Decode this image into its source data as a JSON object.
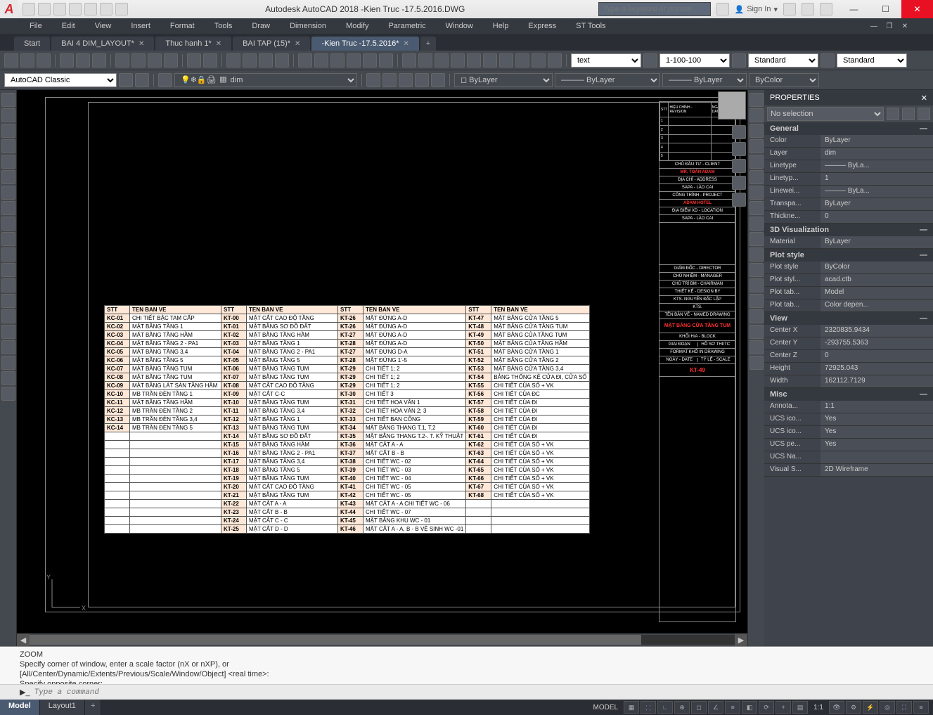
{
  "app": {
    "title": "Autodesk AutoCAD 2018    -Kien Truc -17.5.2016.DWG",
    "search_placeholder": "Type a keyword or phrase",
    "signin": "Sign In"
  },
  "menubar": [
    "File",
    "Edit",
    "View",
    "Insert",
    "Format",
    "Tools",
    "Draw",
    "Dimension",
    "Modify",
    "Parametric",
    "Window",
    "Help",
    "Express",
    "ST Tools"
  ],
  "tabs": [
    {
      "label": "Start",
      "active": false
    },
    {
      "label": "BAI 4 DIM_LAYOUT*",
      "active": false
    },
    {
      "label": "Thuc hanh 1*",
      "active": false
    },
    {
      "label": "BAI TAP (15)*",
      "active": false
    },
    {
      "label": "-Kien Truc -17.5.2016*",
      "active": true
    }
  ],
  "toolbar1": {
    "combo1": "text",
    "combo2": "1-100-100",
    "combo3": "Standard",
    "combo4": "Standard"
  },
  "toolbar2": {
    "workspace": "AutoCAD Classic",
    "layer_combo": "dim",
    "layer1": "ByLayer",
    "layer2": "ByLayer",
    "layer3": "ByLayer",
    "layer4": "ByColor"
  },
  "drawing_table": {
    "headers": [
      "STT",
      "TEN BAN VE",
      "STT",
      "TEN BAN VE",
      "STT",
      "TEN BAN VE",
      "STT",
      "TEN BAN VE"
    ],
    "rows": [
      [
        "KC-01",
        "CHI TIẾT BẬC TAM CẤP",
        "KT-00",
        "MẶT CẮT CAO ĐỘ TẦNG",
        "KT-26",
        "MẶT ĐỨNG A-D",
        "KT-47",
        "MẶT BẰNG CỬA TẦNG 5"
      ],
      [
        "KC-02",
        "MẶT BẰNG TẦNG 1",
        "KT-01",
        "MẶT BẰNG SƠ ĐỒ ĐẤT",
        "KT-26",
        "MẶT ĐỨNG A-D",
        "KT-48",
        "MẶT BẰNG CỬA TẦNG TUM"
      ],
      [
        "KC-03",
        "MẶT BẰNG TẦNG HẦM",
        "KT-02",
        "MẶT BẰNG TẦNG HẦM",
        "KT-27",
        "MẶT ĐỨNG A-D",
        "KT-49",
        "MẶT BẰNG CỦA TẦNG TUM"
      ],
      [
        "KC-04",
        "MẶT BẰNG TẦNG 2 - PA1",
        "KT-03",
        "MẶT BẰNG TẦNG 1",
        "KT-28",
        "MẶT ĐỨNG A-D",
        "KT-50",
        "MẶT BẰNG CỦA TẦNG HẦM"
      ],
      [
        "KC-05",
        "MẶT BẰNG TẦNG 3,4",
        "KT-04",
        "MẶT BẰNG TẦNG 2 - PA1",
        "KT-27",
        "MẶT ĐỨNG D-A",
        "KT-51",
        "MẶT BẰNG CỬA TẦNG 1"
      ],
      [
        "KC-06",
        "MẶT BẰNG TẦNG 5",
        "KT-05",
        "MẶT BẰNG TẦNG 5",
        "KT-28",
        "MẶT ĐỨNG 1'-5",
        "KT-52",
        "MẶT BẰNG CỬA TẦNG 2"
      ],
      [
        "KC-07",
        "MẶT BẰNG TẦNG TUM",
        "KT-06",
        "MẶT BẰNG TẦNG TUM",
        "KT-29",
        "CHI TIẾT 1; 2",
        "KT-53",
        "MẶT BẰNG CỬA TẦNG 3,4"
      ],
      [
        "KC-08",
        "MẶT BẰNG TẦNG TUM",
        "KT-07",
        "MẶT BẰNG TẦNG TUM",
        "KT-29",
        "CHI TIẾT 1; 2",
        "KT-54",
        "BẢNG THỐNG KÊ CỬA ĐI, CỬA SỔ"
      ],
      [
        "KC-09",
        "MẶT BẰNG LÁT SÀN TẦNG HẦM",
        "KT-08",
        "MẶT CẮT CAO ĐỘ TẦNG",
        "KT-29",
        "CHI TIẾT 1; 2",
        "KT-55",
        "CHI TIẾT CỦA SỔ + VK"
      ],
      [
        "KC-10",
        "MB TRẦN ĐÈN TẦNG 1",
        "KT-09",
        "MẶT CẮT C-C",
        "KT-30",
        "CHI TIẾT 3",
        "KT-56",
        "CHI TIẾT CỦA ĐC"
      ],
      [
        "KC-11",
        "MẶT BẰNG TẦNG HẦM",
        "KT-10",
        "MẶT BẰNG TẦNG TUM",
        "KT-31",
        "CHI TIẾT HOA VĂN 1",
        "KT-57",
        "CHI TIẾT CỦA ĐI"
      ],
      [
        "KC-12",
        "MB TRẦN ĐÈN TẦNG 2",
        "KT-11",
        "MẶT BẰNG TẦNG 3,4",
        "KT-32",
        "CHI TIẾT HOA VĂN 2; 3",
        "KT-58",
        "CHI TIẾT CỦA ĐI"
      ],
      [
        "KC-13",
        "MB TRẦN ĐÈN TẦNG 3,4",
        "KT-12",
        "MẶT BẰNG TẦNG 1",
        "KT-33",
        "CHI TIẾT BAN CÔNG",
        "KT-59",
        "CHI TIẾT CỦA ĐI"
      ],
      [
        "KC-14",
        "MB TRẦN ĐÈN TẦNG 5",
        "KT-13",
        "MẶT BẰNG TẦNG TUM",
        "KT-34",
        "MẶT BẰNG THANG T.1, T.2",
        "KT-60",
        "CHI TIẾT CỦA ĐI"
      ],
      [
        "",
        "",
        "KT-14",
        "MẶT BẰNG SƠ ĐỒ ĐẤT",
        "KT-35",
        "MẶT BẰNG THANG T.2-. T. KỸ THUẬT",
        "KT-61",
        "CHI TIẾT CỦA ĐI"
      ],
      [
        "",
        "",
        "KT-15",
        "MẶT BẰNG TẦNG HẦM",
        "KT-36",
        "MẶT CẮT A - A",
        "KT-62",
        "CHI TIẾT CỦA SỔ + VK"
      ],
      [
        "",
        "",
        "KT-16",
        "MẶT BẰNG TẦNG 2 - PA1",
        "KT-37",
        "MẶT CẮT B - B",
        "KT-63",
        "CHI TIẾT CỦA SỔ + VK"
      ],
      [
        "",
        "",
        "KT-17",
        "MẶT BẰNG TẦNG 3,4",
        "KT-38",
        "CHI TIẾT WC - 02",
        "KT-64",
        "CHI TIẾT CỦA SỔ + VK"
      ],
      [
        "",
        "",
        "KT-18",
        "MẶT BẰNG TẦNG 5",
        "KT-39",
        "CHI TIẾT WC - 03",
        "KT-65",
        "CHI TIẾT CỦA SỔ + VK"
      ],
      [
        "",
        "",
        "KT-19",
        "MẶT BẰNG TẦNG TUM",
        "KT-40",
        "CHI TIẾT WC - 04",
        "KT-66",
        "CHI TIẾT CỦA SỔ + VK"
      ],
      [
        "",
        "",
        "KT-20",
        "MẶT CẮT CAO ĐỘ TẦNG",
        "KT-41",
        "CHI TIẾT WC - 05",
        "KT-67",
        "CHI TIẾT CỦA SỔ + VK"
      ],
      [
        "",
        "",
        "KT-21",
        "MẶT BẰNG TẦNG TUM",
        "KT-42",
        "CHI TIẾT WC - 05",
        "KT-68",
        "CHI TIẾT CỦA SỔ + VK"
      ],
      [
        "",
        "",
        "KT-22",
        "MẶT CẮT A - A",
        "KT-43",
        "MẶT CẮT A - A CHI TIẾT WC - 06",
        "",
        ""
      ],
      [
        "",
        "",
        "KT-23",
        "MẶT CẮT B - B",
        "KT-44",
        "CHI TIẾT WC - 07",
        "",
        ""
      ],
      [
        "",
        "",
        "KT-24",
        "MẶT CẮT C - C",
        "KT-45",
        "MẶT BẰNG KHU WC - 01",
        "",
        ""
      ],
      [
        "",
        "",
        "KT-25",
        "MẶT CẮT D - D",
        "KT-46",
        "MẶT CẮT A - A, B - B VỆ SINH WC -01",
        "",
        ""
      ]
    ]
  },
  "titleblock": {
    "rev_header": [
      "STT",
      "HIỆU CHỈNH - REVISION",
      "NGÀY - DATE"
    ],
    "client_label": "CHỦ ĐẦU TƯ - CLIENT",
    "client": "MR. TOÀN ADAM",
    "address_label": "ĐỊA CHỈ - ADDRESS",
    "address": "SAPA - LÀO CAI",
    "project_label": "CÔNG TRÌNH - PROJECT",
    "project": "ADAM HOTEL",
    "location_label": "ĐỊA ĐIỂM XD - LOCATION",
    "location": "SAPA - LÀO CAI",
    "drawing_name_label": "TÊN BẢN VẼ - NAMED DRAWING",
    "drawing_name": "MẶT BẰNG CỬA TẦNG TUM",
    "sheet_no": "KT-49",
    "director": "GIÁM ĐỐC - DIRECTOR",
    "manager": "CHỦ NHIỆM - MANAGER",
    "chairman": "CHỦ TRÌ BM - CHAIRMAN",
    "designer": "THIẾT KẾ - DESIGN BY",
    "designer_name": "KTS. NGUYỄN ĐẮC LẬP",
    "checker": "KTS.",
    "block": "KHỐI H/A - BLOCK",
    "stage": "GIAI ĐOẠN",
    "stage_val": "HỒ SƠ THI/TC",
    "format": "FORMAT KHỔ IN DRAWING",
    "date": "NGÀY - DATE",
    "scale": "TỶ LỆ - SCALE"
  },
  "properties": {
    "header": "PROPERTIES",
    "selection": "No selection",
    "sections": [
      {
        "name": "General",
        "rows": [
          {
            "label": "Color",
            "value": "ByLayer"
          },
          {
            "label": "Layer",
            "value": "dim"
          },
          {
            "label": "Linetype",
            "value": "——— ByLa..."
          },
          {
            "label": "Linetyp...",
            "value": "1"
          },
          {
            "label": "Linewei...",
            "value": "——— ByLa..."
          },
          {
            "label": "Transpa...",
            "value": "ByLayer"
          },
          {
            "label": "Thickne...",
            "value": "0"
          }
        ]
      },
      {
        "name": "3D Visualization",
        "rows": [
          {
            "label": "Material",
            "value": "ByLayer"
          }
        ]
      },
      {
        "name": "Plot style",
        "rows": [
          {
            "label": "Plot style",
            "value": "ByColor"
          },
          {
            "label": "Plot styl...",
            "value": "acad.ctb"
          },
          {
            "label": "Plot tab...",
            "value": "Model"
          },
          {
            "label": "Plot tab...",
            "value": "Color depen..."
          }
        ]
      },
      {
        "name": "View",
        "rows": [
          {
            "label": "Center X",
            "value": "2320835.9434"
          },
          {
            "label": "Center Y",
            "value": "-293755.5363"
          },
          {
            "label": "Center Z",
            "value": "0"
          },
          {
            "label": "Height",
            "value": "72925.043"
          },
          {
            "label": "Width",
            "value": "162112.7129"
          }
        ]
      },
      {
        "name": "Misc",
        "rows": [
          {
            "label": "Annota...",
            "value": "1:1"
          },
          {
            "label": "UCS ico...",
            "value": "Yes"
          },
          {
            "label": "UCS ico...",
            "value": "Yes"
          },
          {
            "label": "UCS pe...",
            "value": "Yes"
          },
          {
            "label": "UCS Na...",
            "value": ""
          },
          {
            "label": "Visual S...",
            "value": "2D Wireframe"
          }
        ]
      }
    ]
  },
  "cmdline": {
    "lines": [
      "ZOOM",
      "Specify corner of window, enter a scale factor (nX or nXP), or",
      "[All/Center/Dynamic/Extents/Previous/Scale/Window/Object] <real time>:",
      "Specify opposite corner:"
    ],
    "prompt": "Type a command"
  },
  "model_tabs": [
    "Model",
    "Layout1"
  ],
  "status": {
    "model": "MODEL",
    "scale": "1:1"
  }
}
